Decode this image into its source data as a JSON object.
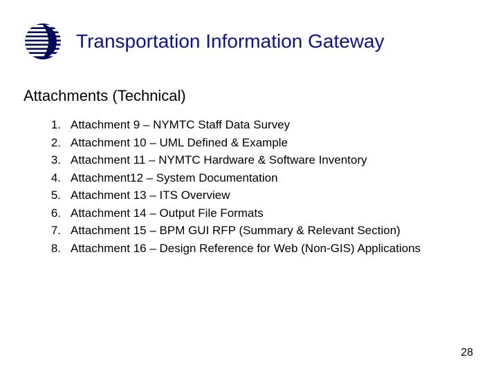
{
  "header": {
    "title": "Transportation Information Gateway"
  },
  "subtitle": "Attachments (Technical)",
  "items": [
    {
      "num": "1.",
      "text": "Attachment 9 – NYMTC Staff Data Survey"
    },
    {
      "num": "2.",
      "text": "Attachment 10 – UML Defined & Example"
    },
    {
      "num": "3.",
      "text": "Attachment 11 – NYMTC Hardware & Software Inventory"
    },
    {
      "num": "4.",
      "text": "Attachment12 – System Documentation"
    },
    {
      "num": "5.",
      "text": "Attachment 13 – ITS Overview"
    },
    {
      "num": "6.",
      "text": "Attachment 14 – Output File Formats"
    },
    {
      "num": "7.",
      "text": "Attachment 15 – BPM GUI RFP (Summary & Relevant Section)"
    },
    {
      "num": "8.",
      "text": "Attachment 16 – Design Reference for Web (Non-GIS) Applications"
    }
  ],
  "page_number": "28"
}
